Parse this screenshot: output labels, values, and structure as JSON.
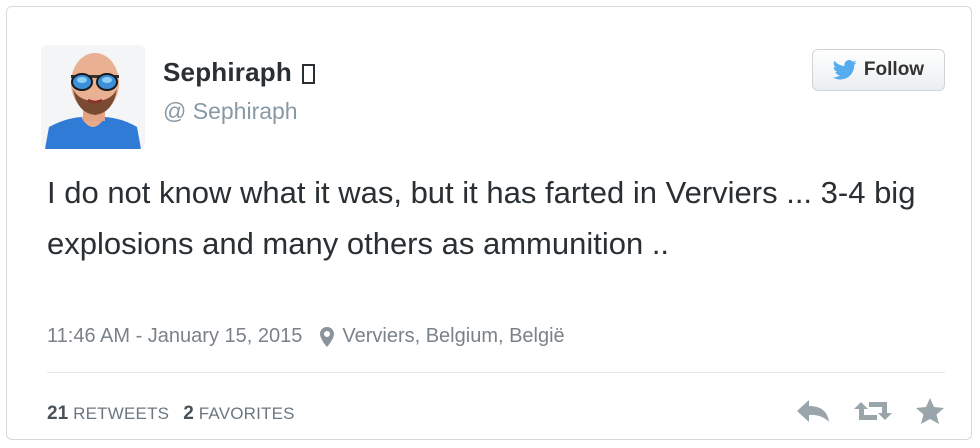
{
  "tweet": {
    "display_name": "Sephiraph",
    "handle": "@ Sephiraph",
    "follow_label": "Follow",
    "text": "I do not know what it was, but it has farted in Verviers ... 3-4 big explosions and many others as ammunition ..",
    "timestamp": "11:46 AM - January 15, 2015",
    "location": "Verviers, Belgium, België",
    "retweets_count": "21",
    "retweets_label": "RETWEETS",
    "favorites_count": "2",
    "favorites_label": "FAVORITES"
  },
  "icons": {
    "follow": "bird-icon",
    "verified": "verified-badge-icon",
    "location": "location-pin-icon",
    "reply": "reply-icon",
    "retweet": "retweet-icon",
    "favorite": "star-icon"
  },
  "colors": {
    "text": "#292f33",
    "muted": "#8899a6",
    "bird": "#55acee",
    "icon_gray": "#9aa4ab"
  }
}
